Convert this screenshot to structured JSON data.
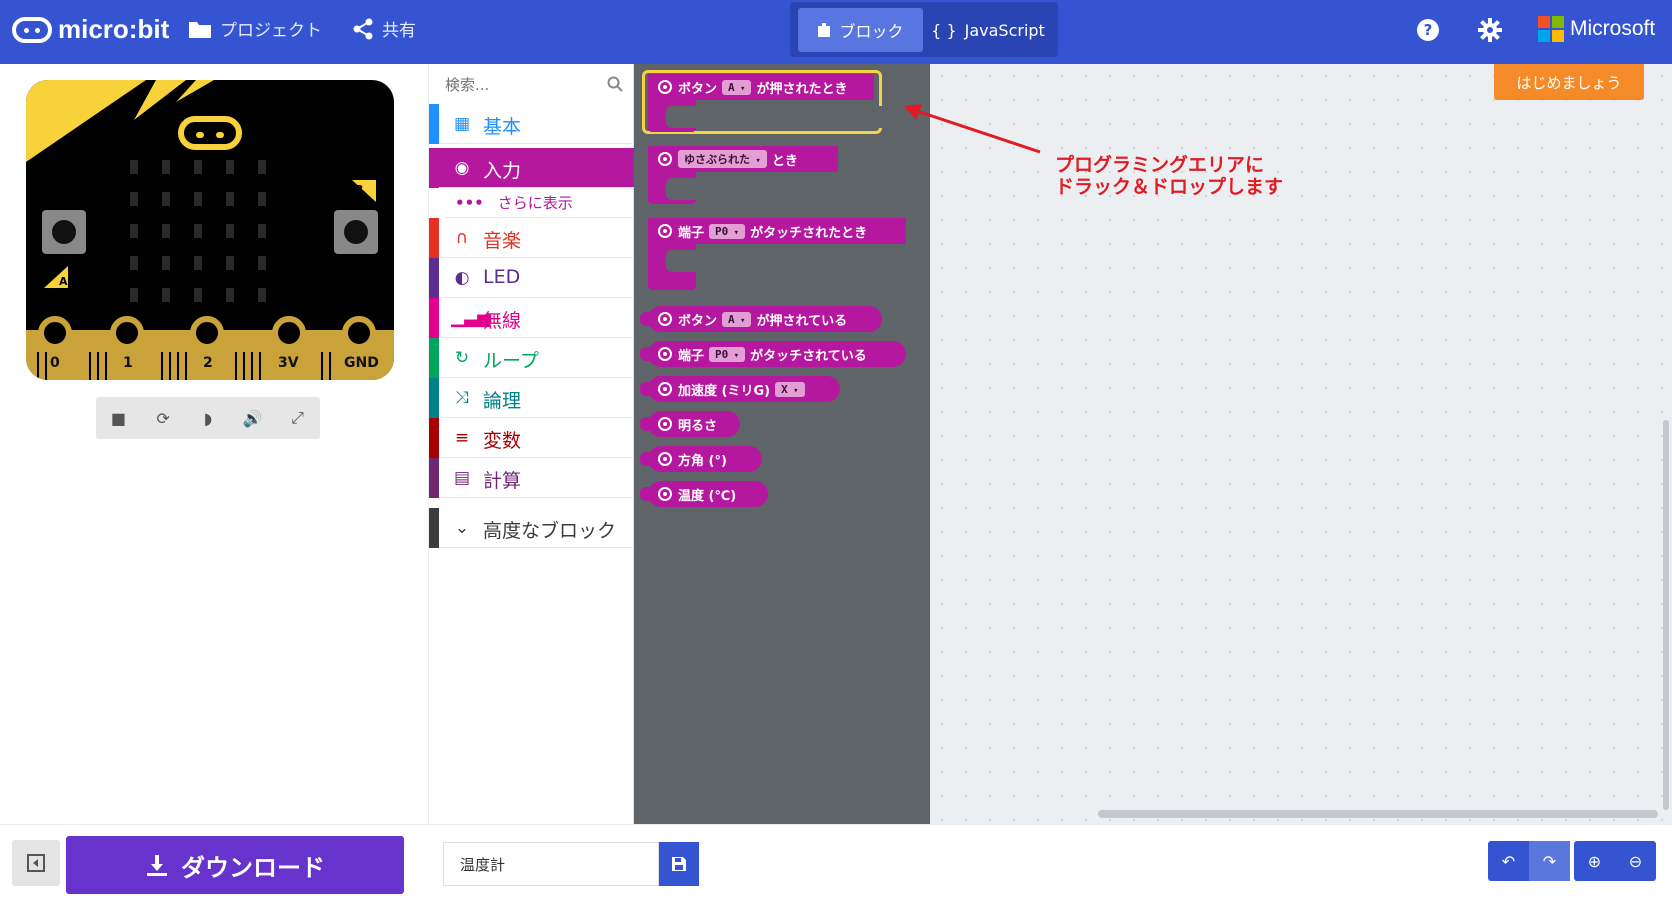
{
  "header": {
    "logo_text": "micro:bit",
    "nav": [
      {
        "label": "プロジェクト",
        "icon": "folder-icon"
      },
      {
        "label": "共有",
        "icon": "share-icon"
      }
    ],
    "editor_toggle": {
      "blocks": "ブロック",
      "javascript": "JavaScript",
      "active": "blocks"
    },
    "brand": "Microsoft",
    "brand_colors": [
      "#f25022",
      "#7fba00",
      "#00a4ef",
      "#ffb900"
    ]
  },
  "simulator": {
    "pins": [
      "0",
      "1",
      "2",
      "3V",
      "GND"
    ],
    "buttons": [
      "A",
      "B"
    ],
    "toolbar": [
      "stop-icon",
      "restart-icon",
      "slowmo-icon",
      "mute-icon",
      "fullscreen-icon"
    ]
  },
  "toolbox": {
    "search_placeholder": "検索...",
    "categories": [
      {
        "label": "基本",
        "color": "#1e90ff",
        "icon": "grid-icon"
      },
      {
        "label": "入力",
        "color": "#b5179e",
        "icon": "target-icon",
        "selected": true
      },
      {
        "label": "音楽",
        "color": "#e63022",
        "icon": "headphones-icon"
      },
      {
        "label": "LED",
        "color": "#5c2d91",
        "icon": "toggle-icon"
      },
      {
        "label": "無線",
        "color": "#e3008c",
        "icon": "signal-icon"
      },
      {
        "label": "ループ",
        "color": "#00a65c",
        "icon": "loop-icon"
      },
      {
        "label": "論理",
        "color": "#00818a",
        "icon": "shuffle-icon"
      },
      {
        "label": "変数",
        "color": "#a80000",
        "icon": "list-icon"
      },
      {
        "label": "計算",
        "color": "#712672",
        "icon": "calculator-icon"
      }
    ],
    "more_label": "さらに表示",
    "advanced_label": "高度なブロック"
  },
  "flyout": {
    "blocks": [
      {
        "pre": "ボタン",
        "chip": "A",
        "post": "が押されたとき"
      },
      {
        "pre": "",
        "chip": "ゆさぶられた",
        "post": "とき"
      },
      {
        "pre": "端子",
        "chip": "P0",
        "post": "がタッチされたとき"
      },
      {
        "pre": "ボタン",
        "chip": "A",
        "post": "が押されている"
      },
      {
        "pre": "端子",
        "chip": "P0",
        "post": "がタッチされている"
      },
      {
        "pre": "加速度 (ミリG)",
        "chip": "X",
        "post": ""
      },
      {
        "pre": "明るさ",
        "chip": "",
        "post": ""
      },
      {
        "pre": "方角 (°)",
        "chip": "",
        "post": ""
      },
      {
        "pre": "温度 (℃)",
        "chip": "",
        "post": ""
      }
    ]
  },
  "workspace": {
    "get_started": "はじめましょう",
    "annotation_line1": "プログラミングエリアに",
    "annotation_line2": "ドラック＆ドロップします"
  },
  "bottom": {
    "download_label": "ダウンロード",
    "project_name": "温度計"
  }
}
